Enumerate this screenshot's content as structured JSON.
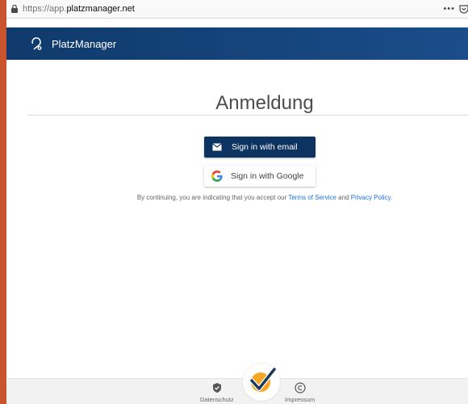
{
  "browser": {
    "url_prefix": "https://app.",
    "url_host": "platzmanager.net",
    "overflow_menu": "•••"
  },
  "header": {
    "brand": "PlatzManager"
  },
  "main": {
    "title": "Anmeldung",
    "email_button_label": "Sign in with email",
    "google_button_label": "Sign in with Google",
    "disclaimer_prefix": "By continuing, you are indicating that you accept our ",
    "terms_link": "Terms of Service",
    "disclaimer_and": " and ",
    "privacy_link": "Privacy Policy",
    "disclaimer_suffix": "."
  },
  "footer": {
    "datenschutz_label": "Datenschutz",
    "impressum_label": "Impressum"
  },
  "colors": {
    "header_bg": "#0f3a6b",
    "email_button_bg": "#0d3460",
    "link": "#1a73e8",
    "badge_accent": "#f5a623",
    "window_edge": "#c9542d"
  }
}
